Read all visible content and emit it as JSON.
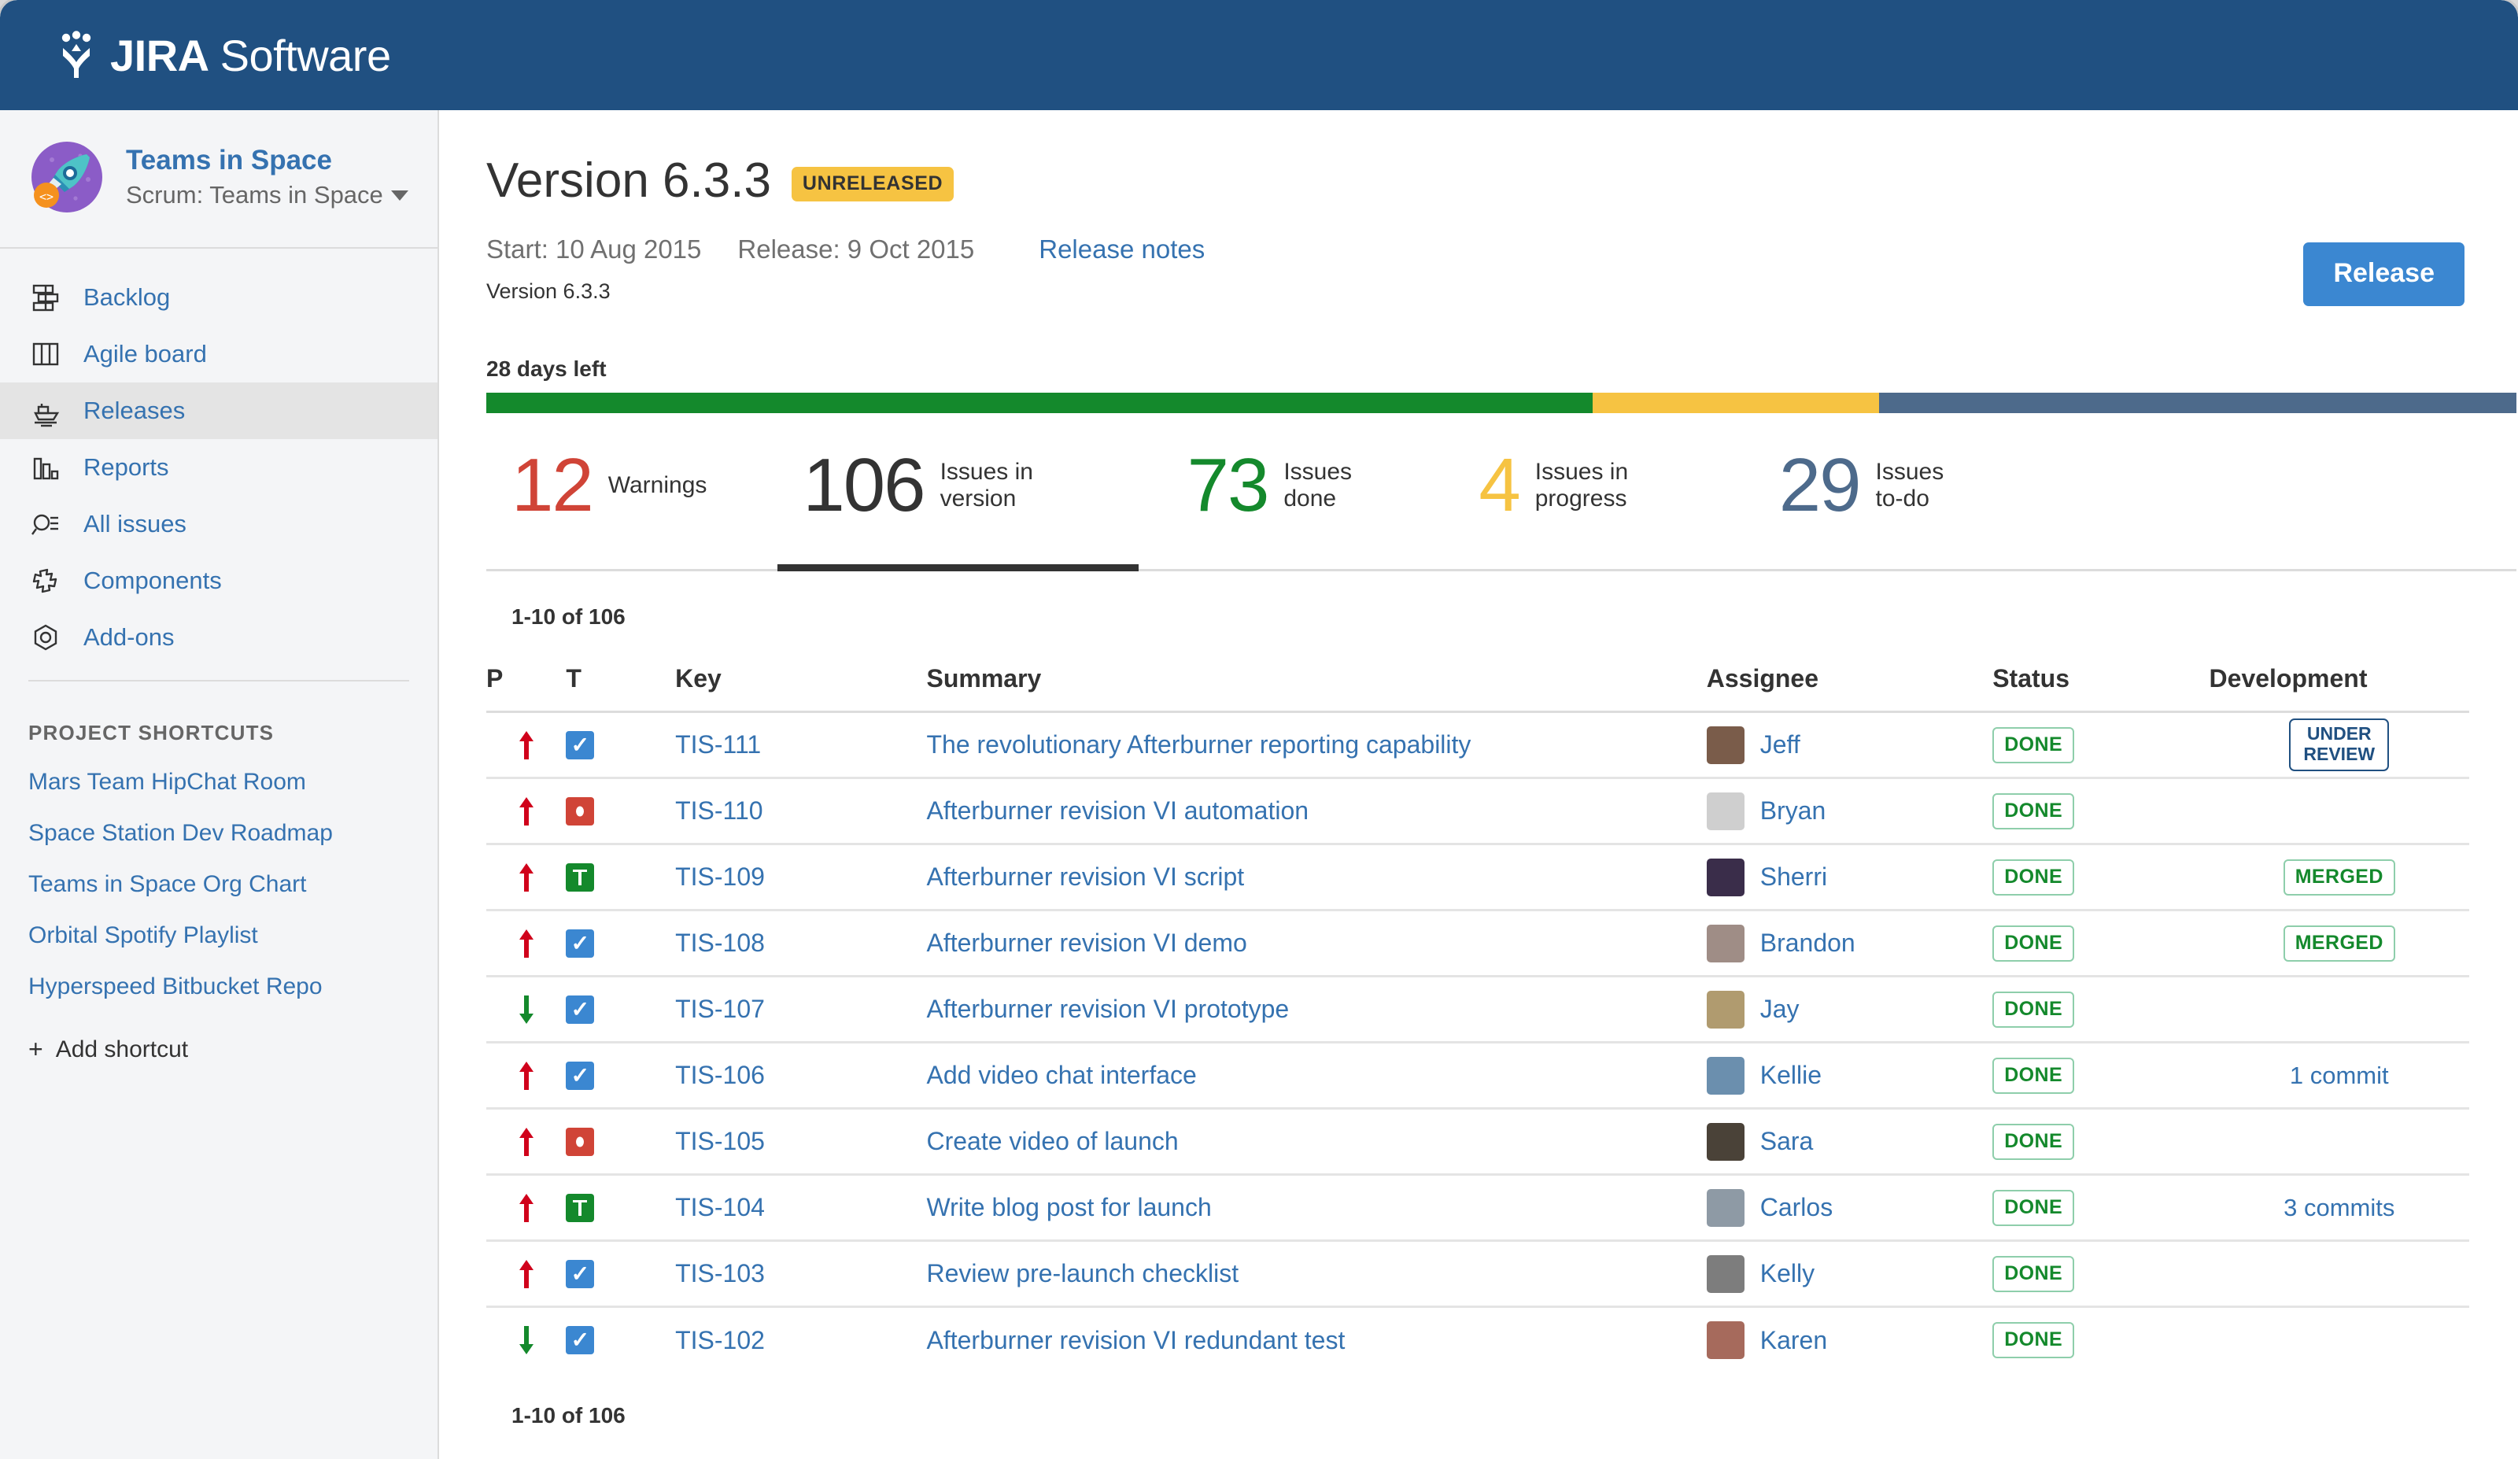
{
  "app": {
    "brand_bold": "JIRA",
    "brand_light": "Software",
    "logo_icon": "jira-logo-icon",
    "header_bg": "#205081"
  },
  "sidebar": {
    "project": {
      "name": "Teams in Space",
      "board": "Scrum: Teams in Space",
      "avatar_icon": "rocket-avatar-icon",
      "caret_icon": "chevron-down-icon"
    },
    "nav": [
      {
        "label": "Backlog",
        "icon": "backlog-icon",
        "active": false
      },
      {
        "label": "Agile board",
        "icon": "board-icon",
        "active": false
      },
      {
        "label": "Releases",
        "icon": "ship-icon",
        "active": true
      },
      {
        "label": "Reports",
        "icon": "bar-chart-icon",
        "active": false
      },
      {
        "label": "All issues",
        "icon": "search-list-icon",
        "active": false
      },
      {
        "label": "Components",
        "icon": "puzzle-icon",
        "active": false
      },
      {
        "label": "Add-ons",
        "icon": "hexagon-icon",
        "active": false
      }
    ],
    "shortcuts_title": "PROJECT SHORTCUTS",
    "shortcuts": [
      "Mars Team HipChat Room",
      "Space Station Dev Roadmap",
      "Teams in Space Org Chart",
      "Orbital Spotify Playlist",
      "Hyperspeed Bitbucket Repo"
    ],
    "add_shortcut": "Add shortcut",
    "add_icon": "plus-icon"
  },
  "header": {
    "title": "Version 6.3.3",
    "status_badge": "UNRELEASED",
    "start": "Start: 10 Aug 2015",
    "release": "Release: 9 Oct 2015",
    "release_notes": "Release notes",
    "description": "Version 6.3.3",
    "days_left": "28 days left",
    "release_button": "Release"
  },
  "progress": {
    "done_pct": 54.5,
    "in_progress_pct": 14.1,
    "todo_pct": 31.4,
    "done_color": "#14892c",
    "in_progress_color": "#f6c342",
    "todo_color": "#4d6a8b"
  },
  "stats": [
    {
      "value": "12",
      "label": "Warnings",
      "color": "#d04437",
      "selected": false
    },
    {
      "value": "106",
      "label": "Issues in version",
      "color": "#333333",
      "selected": true
    },
    {
      "value": "73",
      "label": "Issues done",
      "color": "#14892c",
      "selected": false
    },
    {
      "value": "4",
      "label": "Issues in progress",
      "color": "#f6c342",
      "selected": false
    },
    {
      "value": "29",
      "label": "Issues to-do",
      "color": "#4d6a8b",
      "selected": false
    }
  ],
  "table": {
    "count_top": "1-10 of 106",
    "count_bottom": "1-10 of 106",
    "headers": [
      "P",
      "T",
      "Key",
      "Summary",
      "Assignee",
      "Status",
      "Development"
    ],
    "rows": [
      {
        "priority": "up",
        "type": "task",
        "key": "TIS-111",
        "summary": "The revolutionary Afterburner reporting capability",
        "assignee": "Jeff",
        "avatar": "#7a5c4a",
        "status": "DONE",
        "dev_type": "review",
        "dev": "UNDER REVIEW"
      },
      {
        "priority": "up",
        "type": "bug",
        "key": "TIS-110",
        "summary": "Afterburner revision VI automation",
        "assignee": "Bryan",
        "avatar": "#cfcfcf",
        "status": "DONE",
        "dev_type": "none",
        "dev": ""
      },
      {
        "priority": "up",
        "type": "story",
        "key": "TIS-109",
        "summary": "Afterburner revision VI script",
        "assignee": "Sherri",
        "avatar": "#3a2d4a",
        "status": "DONE",
        "dev_type": "merged",
        "dev": "MERGED"
      },
      {
        "priority": "up",
        "type": "task",
        "key": "TIS-108",
        "summary": "Afterburner revision VI demo",
        "assignee": "Brandon",
        "avatar": "#9f8d86",
        "status": "DONE",
        "dev_type": "merged",
        "dev": "MERGED"
      },
      {
        "priority": "down",
        "type": "task",
        "key": "TIS-107",
        "summary": "Afterburner revision VI prototype",
        "assignee": "Jay",
        "avatar": "#b09b6f",
        "status": "DONE",
        "dev_type": "none",
        "dev": ""
      },
      {
        "priority": "up",
        "type": "task",
        "key": "TIS-106",
        "summary": "Add video chat interface",
        "assignee": "Kellie",
        "avatar": "#6b8fae",
        "status": "DONE",
        "dev_type": "commit",
        "dev": "1 commit"
      },
      {
        "priority": "up",
        "type": "bug",
        "key": "TIS-105",
        "summary": "Create video of launch",
        "assignee": "Sara",
        "avatar": "#4a4238",
        "status": "DONE",
        "dev_type": "none",
        "dev": ""
      },
      {
        "priority": "up",
        "type": "story",
        "key": "TIS-104",
        "summary": "Write blog post for launch",
        "assignee": "Carlos",
        "avatar": "#8e9aa5",
        "status": "DONE",
        "dev_type": "commit",
        "dev": "3 commits"
      },
      {
        "priority": "up",
        "type": "task",
        "key": "TIS-103",
        "summary": "Review pre-launch checklist",
        "assignee": "Kelly",
        "avatar": "#7d7d7d",
        "status": "DONE",
        "dev_type": "none",
        "dev": ""
      },
      {
        "priority": "down",
        "type": "task",
        "key": "TIS-102",
        "summary": "Afterburner revision VI redundant test",
        "assignee": "Karen",
        "avatar": "#a66a5c",
        "status": "DONE",
        "dev_type": "none",
        "dev": ""
      }
    ]
  }
}
